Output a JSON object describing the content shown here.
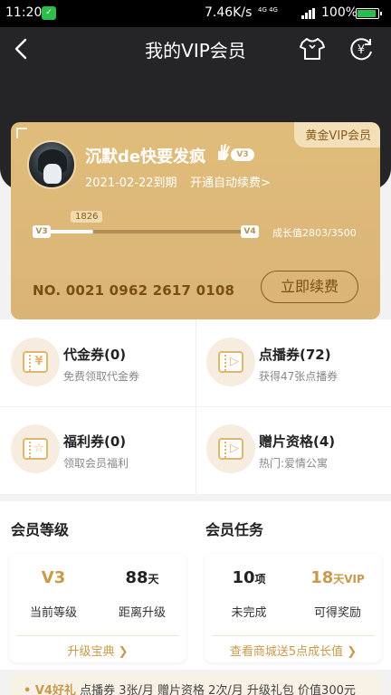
{
  "status_bar": {
    "time": "11:20",
    "network_speed": "7.46K/s",
    "signal_text": "4G 4G",
    "battery": "100%"
  },
  "header": {
    "title": "我的VIP会员"
  },
  "vip_card": {
    "badge": "黄金VIP会员",
    "username": "沉默de快要发疯",
    "level_badge": "V3",
    "expire": "2021-02-22到期",
    "auto_renew": "开通自动续费>",
    "progress": {
      "start_level": "V3",
      "end_level": "V4",
      "tip": "1826",
      "fraction": 0.24
    },
    "growth": "成长值2803/3500",
    "vip_no": "NO. 0021 0962 2617 0108",
    "renew_button": "立即续费"
  },
  "coupons": [
    {
      "name": "代金券(0)",
      "sub": "免费领取代金券",
      "icon": "yen-ticket-icon",
      "sym": "¥"
    },
    {
      "name": "点播券(72)",
      "sub": "获得47张点播券",
      "icon": "play-ticket-icon",
      "sym": "▷"
    },
    {
      "name": "福利券(0)",
      "sub": "领取会员福利",
      "icon": "star-ticket-icon",
      "sym": "☆"
    },
    {
      "name": "赠片资格(4)",
      "sub": "热门:爱情公寓",
      "icon": "gift-film-icon",
      "sym": "▷"
    }
  ],
  "member_level": {
    "title": "会员等级",
    "current_value": "V3",
    "current_label": "当前等级",
    "days_value": "88",
    "days_unit": "天",
    "days_label": "距离升级",
    "link": "升级宝典 ❯"
  },
  "member_tasks": {
    "title": "会员任务",
    "incomplete_value": "10",
    "incomplete_unit": "项",
    "incomplete_label": "未完成",
    "reward_value": "18",
    "reward_unit": "天VIP",
    "reward_label": "可得奖励",
    "link": "查看商城送5点成长值 ❯"
  },
  "bottom_tip": {
    "highlight": "• V4好礼",
    "text": "点播券 3张/月  赠片资格 2次/月  升级礼包 价值300元"
  },
  "colors": {
    "gold": "#d9b475",
    "accent": "#c99a4b",
    "header_bg": "#252527"
  }
}
